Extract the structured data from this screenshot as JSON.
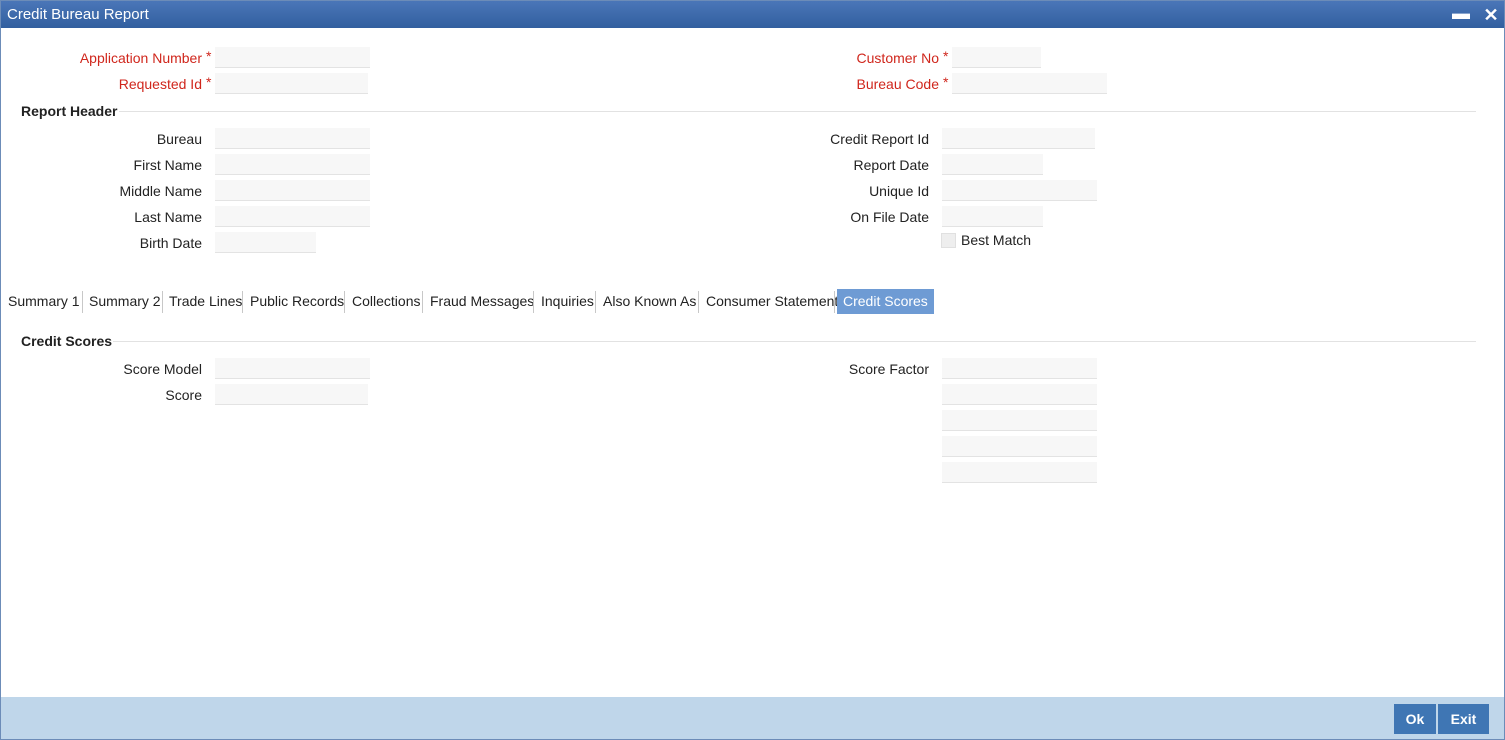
{
  "window": {
    "title": "Credit Bureau Report",
    "minimize_glyph": "▬",
    "close_glyph": "✕"
  },
  "header_fields": {
    "application_number": {
      "label": "Application Number",
      "value": ""
    },
    "requested_id": {
      "label": "Requested Id",
      "value": ""
    },
    "customer_no": {
      "label": "Customer No",
      "value": ""
    },
    "bureau_code": {
      "label": "Bureau Code",
      "value": ""
    },
    "required_marker": "*"
  },
  "report_header": {
    "title": "Report Header",
    "bureau": {
      "label": "Bureau",
      "value": ""
    },
    "first_name": {
      "label": "First Name",
      "value": ""
    },
    "middle_name": {
      "label": "Middle Name",
      "value": ""
    },
    "last_name": {
      "label": "Last Name",
      "value": ""
    },
    "birth_date": {
      "label": "Birth Date",
      "value": ""
    },
    "credit_report_id": {
      "label": "Credit Report Id",
      "value": ""
    },
    "report_date": {
      "label": "Report Date",
      "value": ""
    },
    "unique_id": {
      "label": "Unique Id",
      "value": ""
    },
    "on_file_date": {
      "label": "On File Date",
      "value": ""
    },
    "best_match": {
      "label": "Best Match",
      "checked": false
    }
  },
  "tabs": [
    {
      "label": "Summary 1"
    },
    {
      "label": "Summary 2"
    },
    {
      "label": "Trade Lines"
    },
    {
      "label": "Public Records"
    },
    {
      "label": "Collections"
    },
    {
      "label": "Fraud Messages"
    },
    {
      "label": "Inquiries"
    },
    {
      "label": "Also Known As"
    },
    {
      "label": "Consumer Statement"
    },
    {
      "label": "Credit Scores",
      "active": true
    }
  ],
  "credit_scores": {
    "title": "Credit Scores",
    "score_model": {
      "label": "Score Model",
      "value": ""
    },
    "score": {
      "label": "Score",
      "value": ""
    },
    "score_factor": {
      "label": "Score Factor",
      "values": [
        "",
        "",
        "",
        "",
        ""
      ]
    }
  },
  "footer": {
    "ok_label": "Ok",
    "exit_label": "Exit"
  },
  "colors": {
    "title_bar": "#3a67a8",
    "required": "#d0261c",
    "active_tab": "#6e9bd4",
    "footer": "#bfd6ea",
    "button": "#3f76b4"
  }
}
